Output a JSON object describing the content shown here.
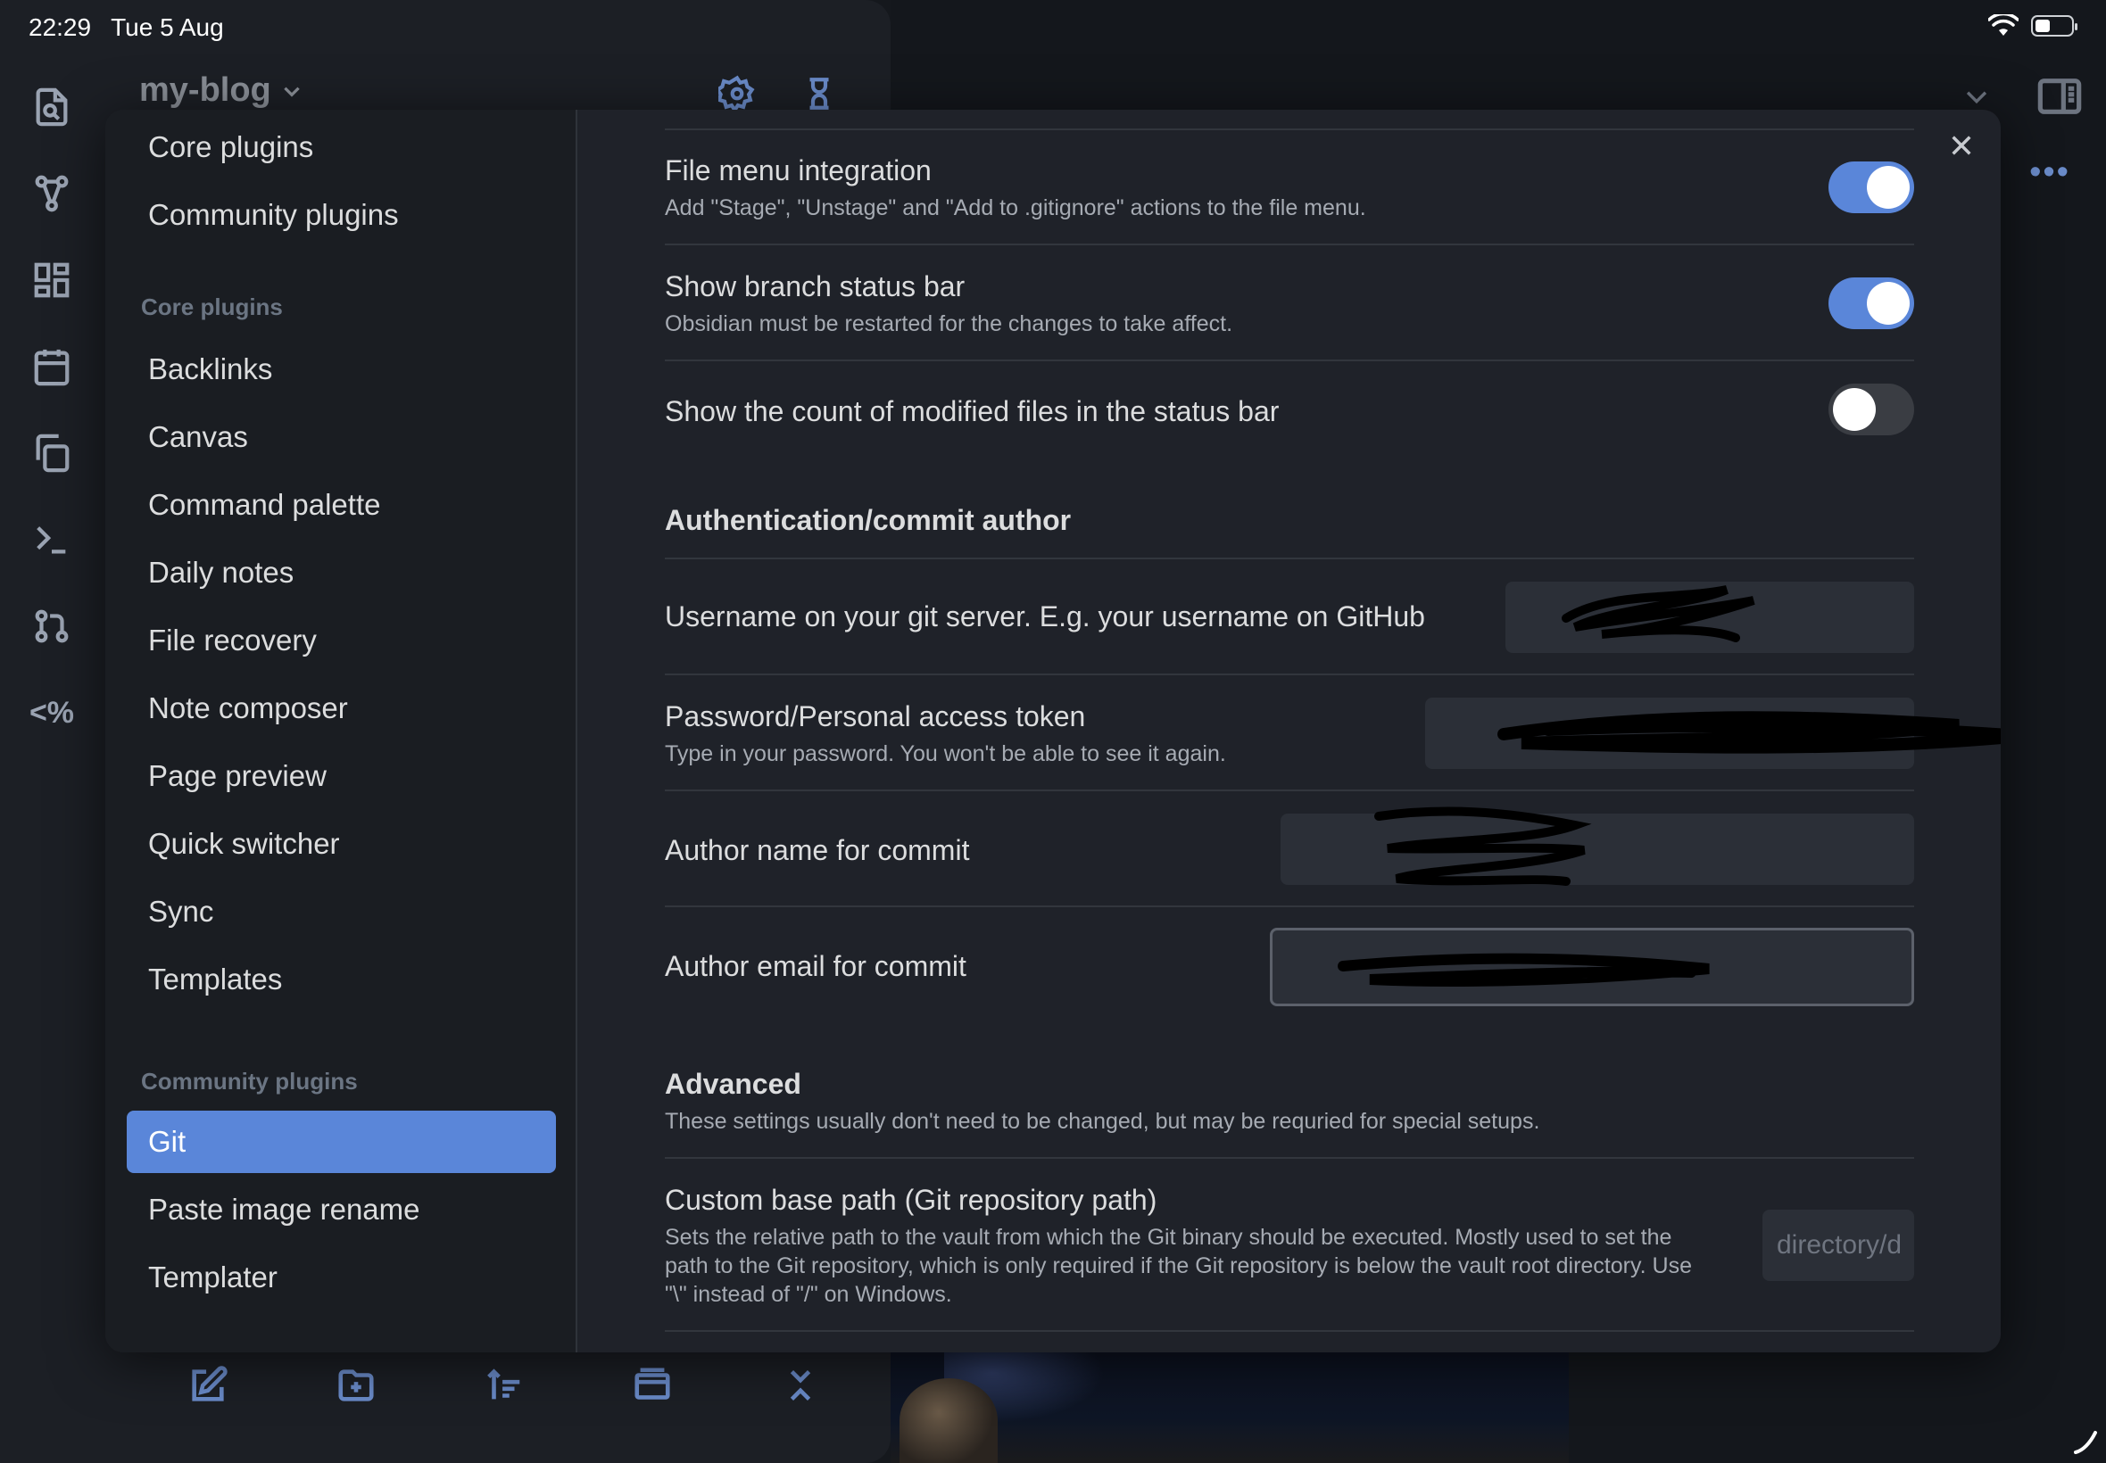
{
  "status": {
    "time": "22:29",
    "date": "Tue 5 Aug"
  },
  "vault": {
    "name": "my-blog"
  },
  "ribbon": [
    "file-search-icon",
    "graph-icon",
    "layout-icon",
    "calendar-icon",
    "copy-icon",
    "terminal-icon",
    "git-pull-request-icon",
    "templater-icon"
  ],
  "ribbon_text": {
    "templater": "<%"
  },
  "sidebar": {
    "top_items": [
      {
        "label": "Core plugins"
      },
      {
        "label": "Community plugins"
      }
    ],
    "core_heading": "Core plugins",
    "core_items": [
      {
        "label": "Backlinks"
      },
      {
        "label": "Canvas"
      },
      {
        "label": "Command palette"
      },
      {
        "label": "Daily notes"
      },
      {
        "label": "File recovery"
      },
      {
        "label": "Note composer"
      },
      {
        "label": "Page preview"
      },
      {
        "label": "Quick switcher"
      },
      {
        "label": "Sync"
      },
      {
        "label": "Templates"
      }
    ],
    "community_heading": "Community plugins",
    "community_items": [
      {
        "label": "Git",
        "active": true
      },
      {
        "label": "Paste image rename"
      },
      {
        "label": "Templater"
      }
    ]
  },
  "settings": {
    "file_menu": {
      "name": "File menu integration",
      "desc": "Add \"Stage\", \"Unstage\" and \"Add to .gitignore\" actions to the file menu.",
      "enabled": true
    },
    "branch_status": {
      "name": "Show branch status bar",
      "desc": "Obsidian must be restarted for the changes to take affect.",
      "enabled": true
    },
    "modified_count": {
      "name": "Show the count of modified files in the status bar",
      "enabled": false
    },
    "auth_heading": "Authentication/commit author",
    "username": {
      "name": "Username on your git server. E.g. your username on GitHub",
      "value": ""
    },
    "password": {
      "name": "Password/Personal access token",
      "desc": "Type in your password. You won't be able to see it again.",
      "value": ""
    },
    "author_name": {
      "name": "Author name for commit",
      "value": ""
    },
    "author_email": {
      "name": "Author email for commit",
      "value": ""
    },
    "advanced_heading": "Advanced",
    "advanced_desc": "These settings usually don't need to be changed, but may be requried for special setups.",
    "base_path": {
      "name": "Custom base path (Git repository path)",
      "desc": "Sets the relative path to the vault from which the Git binary should be executed. Mostly used to set the path to the Git repository, which is only required if the Git repository is below the vault root directory. Use \"\\\" instead of \"/\" on Windows.",
      "placeholder": "directory/directory-with-git-repo"
    }
  },
  "colors": {
    "accent": "#5a86d9",
    "background": "#1f2229",
    "sidebar": "#1a1d22"
  }
}
